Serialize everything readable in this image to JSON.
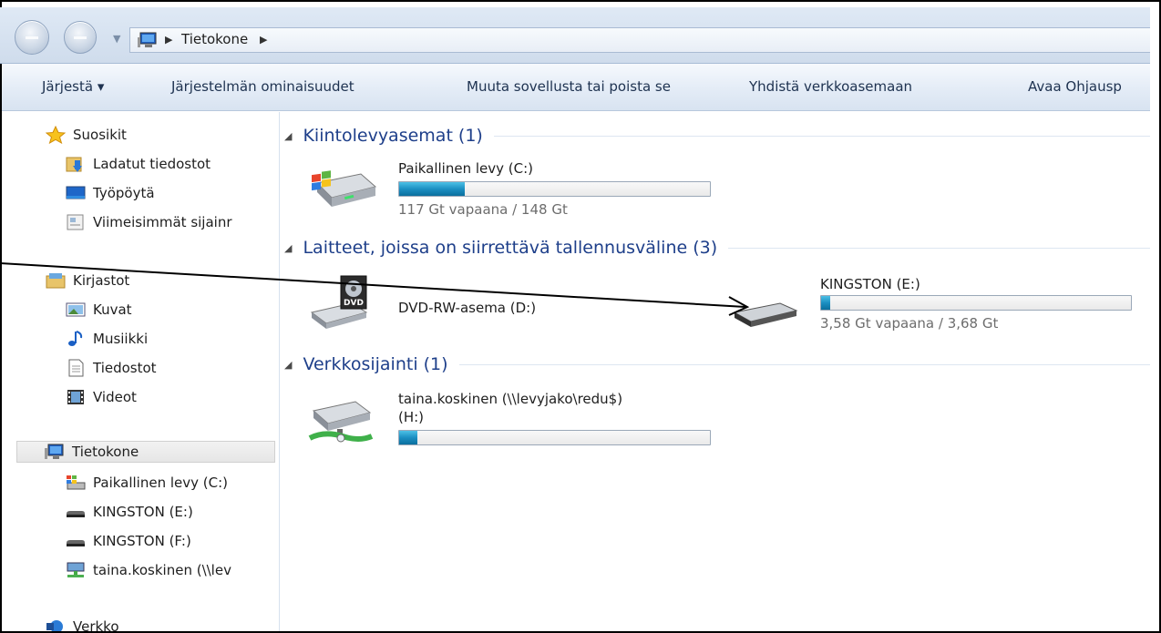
{
  "address": {
    "crumbs": [
      "Tietokone"
    ]
  },
  "toolbar": {
    "organize": "Järjestä ▾",
    "system_properties": "Järjestelmän ominaisuudet",
    "uninstall": "Muuta sovellusta tai poista se",
    "map_drive": "Yhdistä verkkoasemaan",
    "control_panel": "Avaa Ohjausp"
  },
  "nav": {
    "favorites": "Suosikit",
    "downloads": "Ladatut tiedostot",
    "desktop": "Työpöytä",
    "recent": "Viimeisimmät sijainr",
    "libraries": "Kirjastot",
    "pictures": "Kuvat",
    "music": "Musiikki",
    "documents": "Tiedostot",
    "videos": "Videot",
    "computer": "Tietokone",
    "drive_c": "Paikallinen levy (C:)",
    "drive_e": "KINGSTON (E:)",
    "drive_f": "KINGSTON (F:)",
    "drive_h": "taina.koskinen (\\\\lev",
    "network": "Verkko"
  },
  "groups": {
    "hdd": "Kiintolevyasemat (1)",
    "removable": "Laitteet, joissa on siirrettävä tallennusväline (3)",
    "network": "Verkkosijainti (1)"
  },
  "drives": {
    "c": {
      "name": "Paikallinen levy (C:)",
      "free": "117 Gt vapaana / 148 Gt",
      "used_fraction": 0.21
    },
    "d": {
      "name": "DVD-RW-asema (D:)"
    },
    "e": {
      "name": "KINGSTON (E:)",
      "free": "3,58 Gt vapaana / 3,68 Gt",
      "used_fraction": 0.03
    },
    "h": {
      "name_line1": "taina.koskinen (\\\\levyjako\\redu$)",
      "name_line2": "(H:)",
      "used_fraction": 0.06
    }
  },
  "colors": {
    "group_title": "#1e3f8a",
    "bar_fill": "#1b8fc2"
  }
}
